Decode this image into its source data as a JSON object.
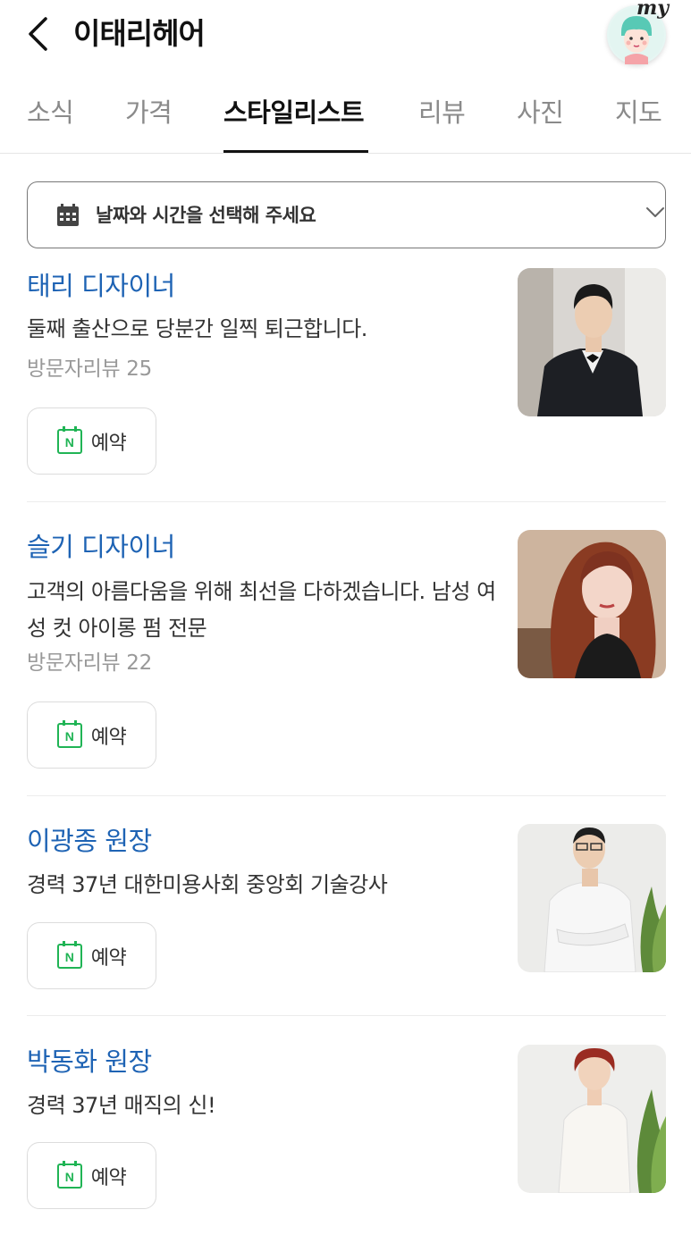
{
  "header": {
    "title": "이태리헤어",
    "my_label": "my"
  },
  "tabs": [
    {
      "label": "소식",
      "active": false
    },
    {
      "label": "가격",
      "active": false
    },
    {
      "label": "스타일리스트",
      "active": true
    },
    {
      "label": "리뷰",
      "active": false
    },
    {
      "label": "사진",
      "active": false
    },
    {
      "label": "지도",
      "active": false
    }
  ],
  "date_select": {
    "label": "날짜와 시간을 선택해 주세요",
    "icon": "calendar-icon"
  },
  "stylists": [
    {
      "name": "태리 디자이너",
      "description": "둘째 출산으로 당분간 일찍 퇴근합니다.",
      "reviews": "방문자리뷰 25",
      "book_label": "예약"
    },
    {
      "name": "슬기 디자이너",
      "description": "고객의 아름다움을 위해 최선을 다하겠습니다. 남성 여성 컷 아이롱 펌 전문",
      "reviews": "방문자리뷰 22",
      "book_label": "예약"
    },
    {
      "name": "이광종 원장",
      "description": "경력 37년 대한미용사회 중앙회 기술강사",
      "reviews": "",
      "book_label": "예약"
    },
    {
      "name": "박동화 원장",
      "description": "경력 37년 매직의 신!",
      "reviews": "",
      "book_label": "예약"
    }
  ],
  "colors": {
    "link_blue": "#1e63b4",
    "naver_green": "#20b455"
  }
}
